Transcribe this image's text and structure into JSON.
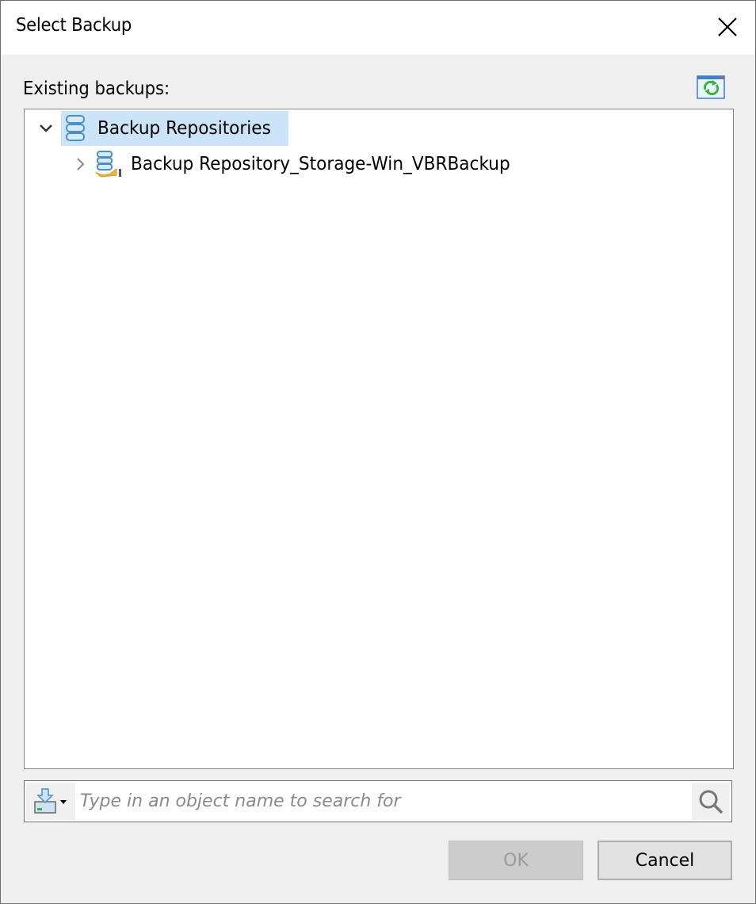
{
  "window": {
    "title": "Select Backup",
    "close_icon": "close-x-icon"
  },
  "panel": {
    "label": "Existing backups:",
    "refresh_icon": "refresh-icon"
  },
  "tree": {
    "items": [
      {
        "label": "Backup Repositories",
        "expanded": true,
        "selected": true,
        "icon": "database-icon",
        "children": [
          {
            "label": "Backup Repository_Storage-Win_VBRBackup",
            "expanded": false,
            "selected": false,
            "icon": "backup-repository-icon"
          }
        ]
      }
    ]
  },
  "search": {
    "placeholder": "Type in an object name to search for",
    "value": "",
    "scope_icon": "search-scope-icon",
    "search_icon": "magnifier-icon"
  },
  "buttons": {
    "ok_label": "OK",
    "ok_enabled": false,
    "cancel_label": "Cancel"
  },
  "colors": {
    "selection": "#cce4f7",
    "refresh_green": "#3cb43c",
    "icon_blue": "#4a90c8"
  }
}
